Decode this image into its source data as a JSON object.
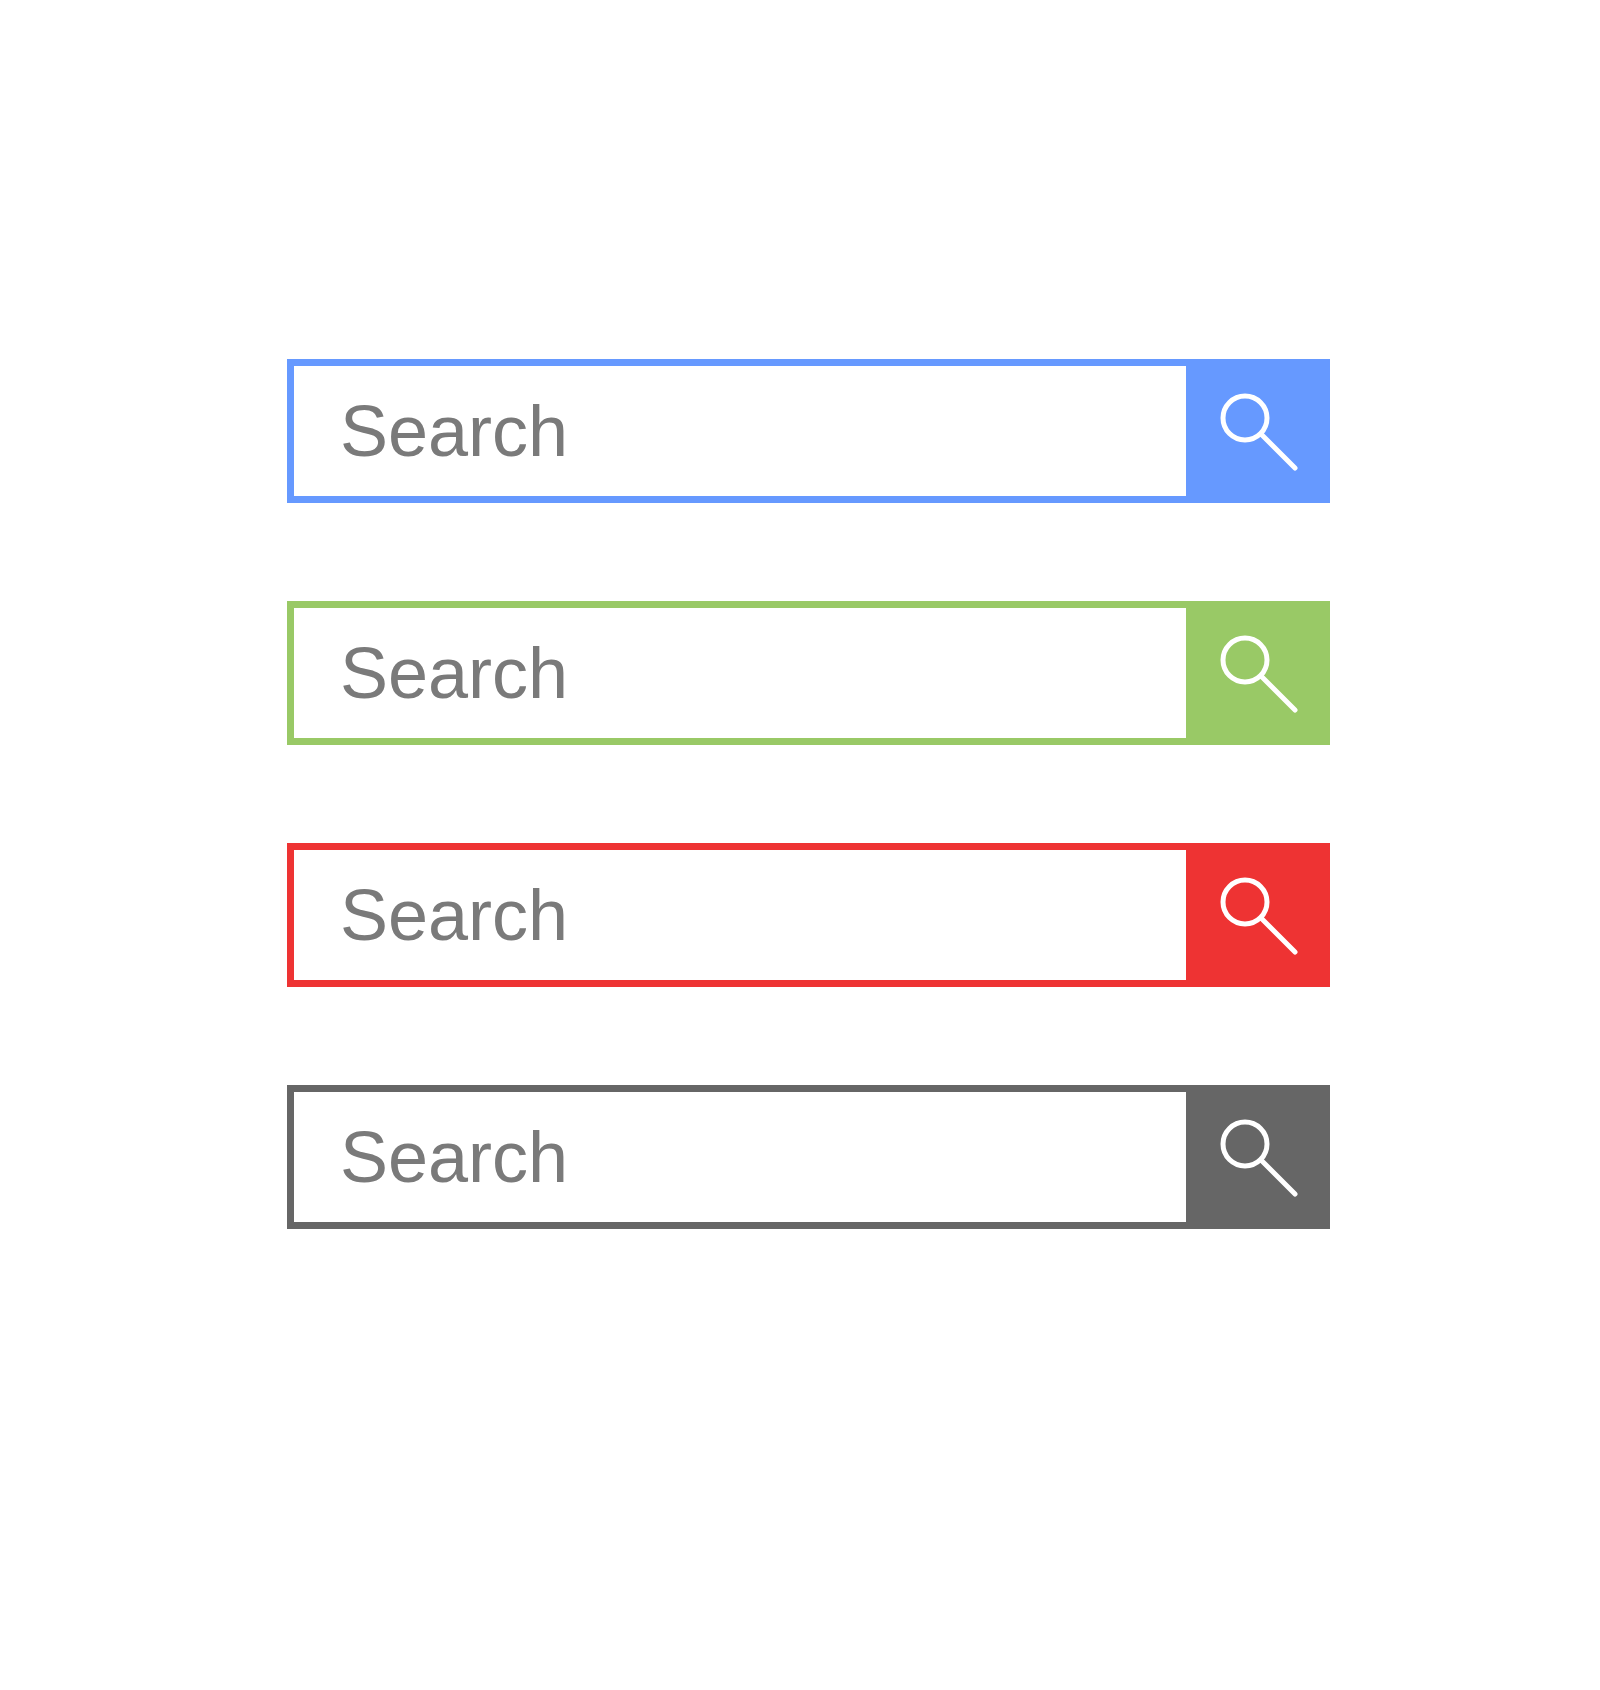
{
  "search_bars": [
    {
      "placeholder": "Search",
      "color": "#6699ff"
    },
    {
      "placeholder": "Search",
      "color": "#99c966"
    },
    {
      "placeholder": "Search",
      "color": "#ee3333"
    },
    {
      "placeholder": "Search",
      "color": "#666666"
    }
  ]
}
